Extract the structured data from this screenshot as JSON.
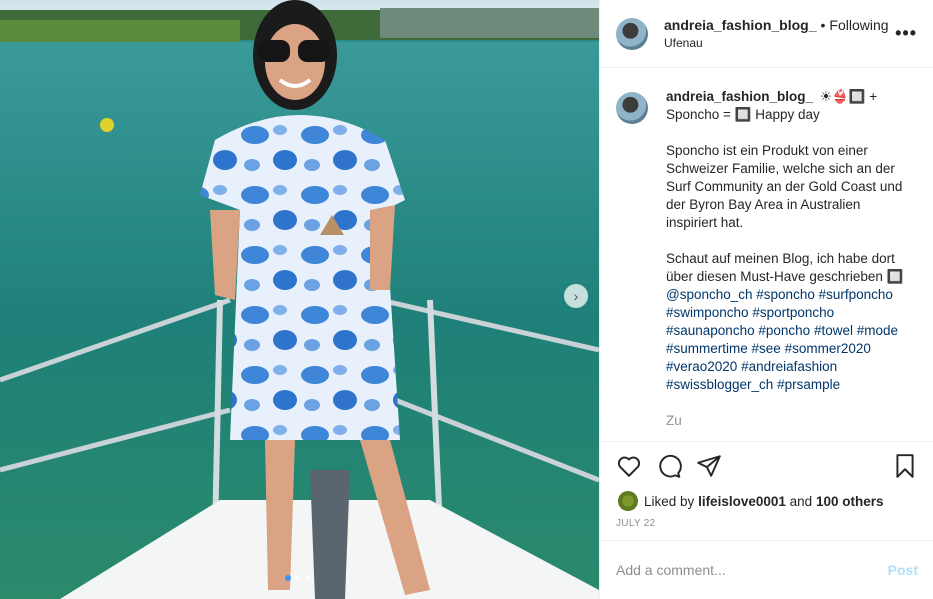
{
  "post": {
    "username": "andreia_fashion_blog_",
    "separator": "•",
    "follow_status": "Following",
    "location": "Ufenau",
    "more_label": "•••"
  },
  "caption": {
    "username": "andreia_fashion_blog_",
    "line1": "☀👙🔲 + Sponcho = 🔲 Happy day",
    "para1": "Sponcho ist ein Produkt von einer Schweizer Familie, welche sich an der Surf Community an der Gold Coast und der Byron Bay Area in Australien inspiriert hat.",
    "para2": "Schaut auf meinen Blog, ich habe dort über diesen Must-Have geschrieben 🔲",
    "tags": [
      "@sponcho_ch",
      "#sponcho",
      "#surfponcho",
      "#swimponcho",
      "#sportponcho",
      "#saunaponcho",
      "#poncho",
      "#towel",
      "#mode",
      "#summertime",
      "#see",
      "#sommer2020",
      "#verao2020",
      "#andreiafashion",
      "#swissblogger_ch",
      "#prsample"
    ],
    "more_text": "Zu"
  },
  "likes": {
    "prefix": "Liked by",
    "user": "lifeislove0001",
    "conj": "and",
    "others": "100 others"
  },
  "date": "JULY 22",
  "comment": {
    "placeholder": "Add a comment...",
    "post_label": "Post"
  },
  "carousel": {
    "next_label": "›",
    "slide_count": 3,
    "active_index": 0
  },
  "colors": {
    "link": "#00376b",
    "post_disabled": "#b2dffc",
    "active_dot": "#3897f0"
  }
}
